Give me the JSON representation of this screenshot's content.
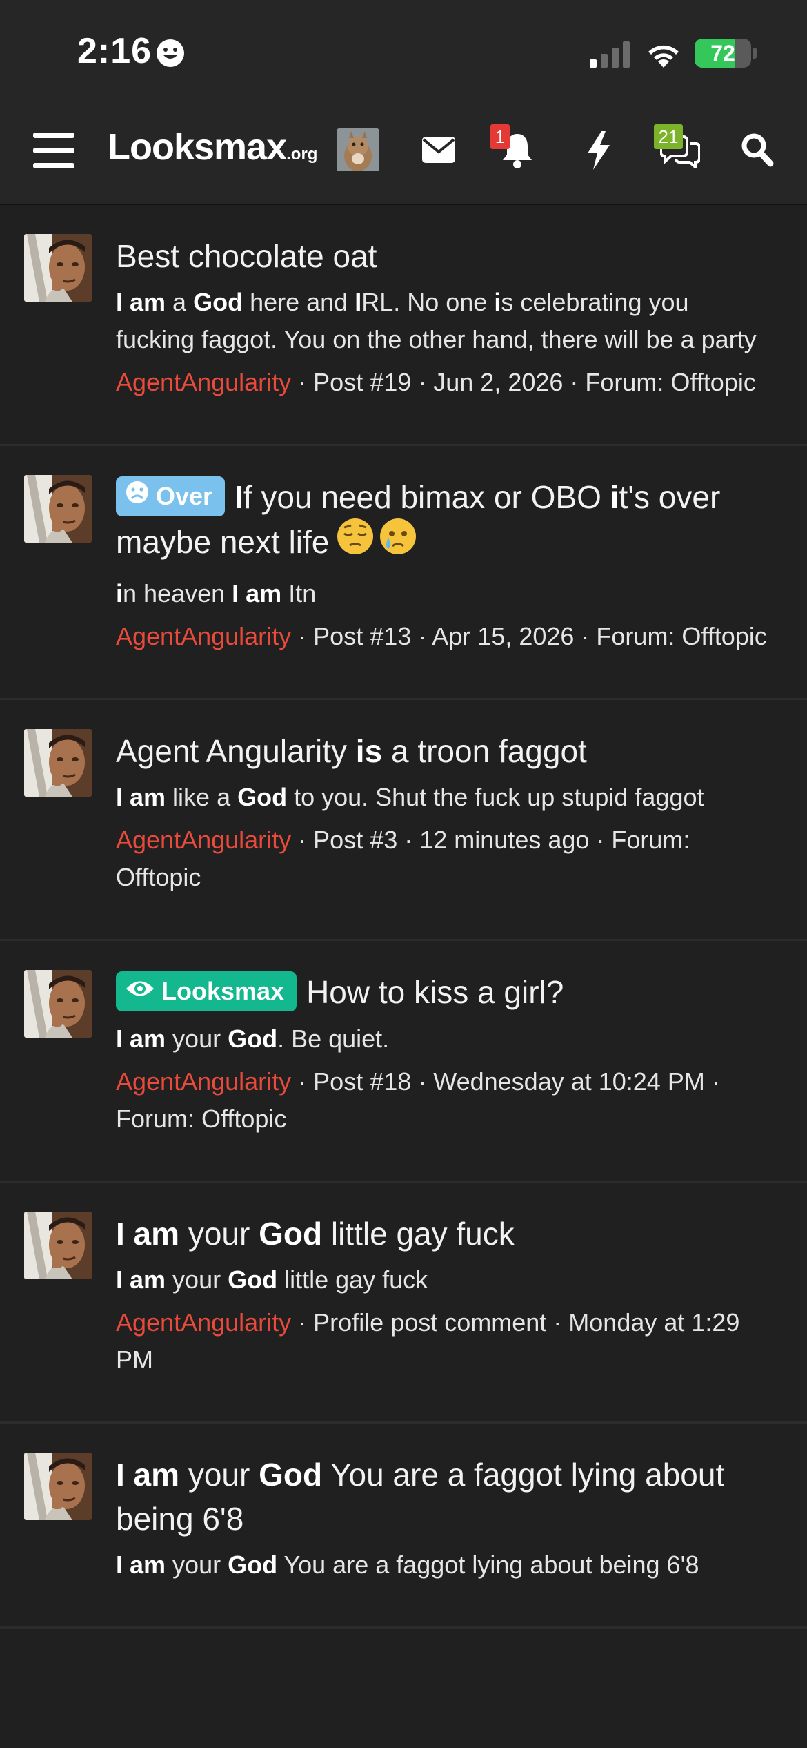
{
  "status_bar": {
    "time": "2:16",
    "battery_percent": "72",
    "battery_level": 0.72
  },
  "navbar": {
    "logo_main": "Looksmax",
    "logo_suffix": ".org",
    "notification_count": "1",
    "conversation_count": "21",
    "colors": {
      "badge_red": "#e53935",
      "badge_green": "#7cb32a"
    }
  },
  "results": [
    {
      "title_html": "Best chocolate oat",
      "label": null,
      "snippet_html": "<b class=\"hl\">I am</b> a <b class=\"hl\">God</b> here and <b class=\"hl\">I</b>RL. No one <b class=\"hl\">i</b>s celebrating you fucking faggot. You on the other hand, there will be a party",
      "author": "AgentAngularity",
      "meta": " · Post #19 · Jun 2, 2026 · Forum: Offtopic"
    },
    {
      "title_html": "<b class=\"hl\">I</b>f you need bimax or OBO <b class=\"hl\">i</b>t's over maybe next life",
      "label": {
        "text": "Over",
        "kind": "over"
      },
      "emoji": true,
      "snippet_html": "<b class=\"hl\">i</b>n heaven <b class=\"hl\">I am</b> Itn",
      "author": "AgentAngularity",
      "meta": " · Post #13 · Apr 15, 2026 · Forum: Offtopic"
    },
    {
      "title_html": "Agent Angularity <b class=\"hl\">is</b> a troon faggot",
      "label": null,
      "snippet_html": "<b class=\"hl\">I am</b> like a <b class=\"hl\">God</b> to you. Shut the fuck up stupid faggot",
      "author": "AgentAngularity",
      "meta": " · Post #3 · 12 minutes ago · Forum: Offtopic"
    },
    {
      "title_html": "How to kiss a girl?",
      "label": {
        "text": "Looksmax",
        "kind": "looksmax"
      },
      "snippet_html": "<b class=\"hl\">I am</b> your <b class=\"hl\">God</b>. Be quiet.",
      "author": "AgentAngularity",
      "meta": " · Post #18 · Wednesday at 10:24 PM · Forum: Offtopic"
    },
    {
      "title_html": "<b class=\"hl\">I am</b> your <b class=\"hl\">God</b> little gay fuck",
      "label": null,
      "snippet_html": "<b class=\"hl\">I am</b> your <b class=\"hl\">God</b> little gay fuck",
      "author": "AgentAngularity",
      "meta": " · Profile post comment · Monday at 1:29 PM"
    },
    {
      "title_html": "<b class=\"hl\">I am</b> your <b class=\"hl\">God</b> You are a faggot lying about being 6'8",
      "label": null,
      "snippet_html": "<b class=\"hl\">I am</b> your <b class=\"hl\">God</b> You are a faggot lying about being 6'8",
      "author": "",
      "meta": ""
    }
  ]
}
